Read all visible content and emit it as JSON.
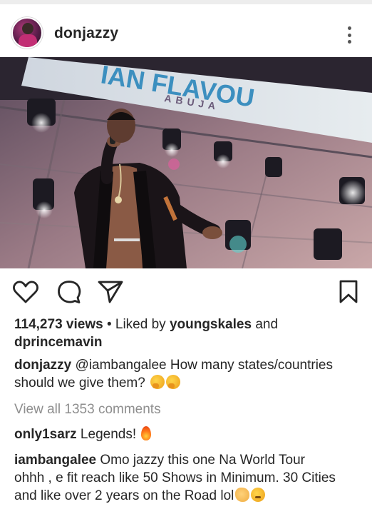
{
  "post": {
    "username": "donjazzy",
    "views": "114,273 views",
    "liked_by_prefix": " • Liked by ",
    "liked_by_user1": "youngskales",
    "liked_by_and": " and",
    "liked_by_user2": "dprincemavin",
    "caption_user": "donjazzy",
    "caption_mention": "@iambangalee",
    "caption_text_1": " How many states/countries",
    "caption_text_2": "should we give them?",
    "view_all_comments": "View all 1353 comments",
    "image_banner_text": "IAN FLAVOU",
    "image_banner_sub": "ABUJA"
  },
  "comments": [
    {
      "user": "only1sarz",
      "text": " Legends!"
    },
    {
      "user": "iambangalee",
      "line1": " Omo jazzy this one Na World Tour",
      "line2": "ohhh , e fit reach like 50 Shows in Minimum. 30 Cities",
      "line3": "and like over 2 years on the Road lol"
    }
  ],
  "icons": [
    "more-options-icon",
    "heart-icon",
    "comment-icon",
    "share-icon",
    "bookmark-icon"
  ]
}
